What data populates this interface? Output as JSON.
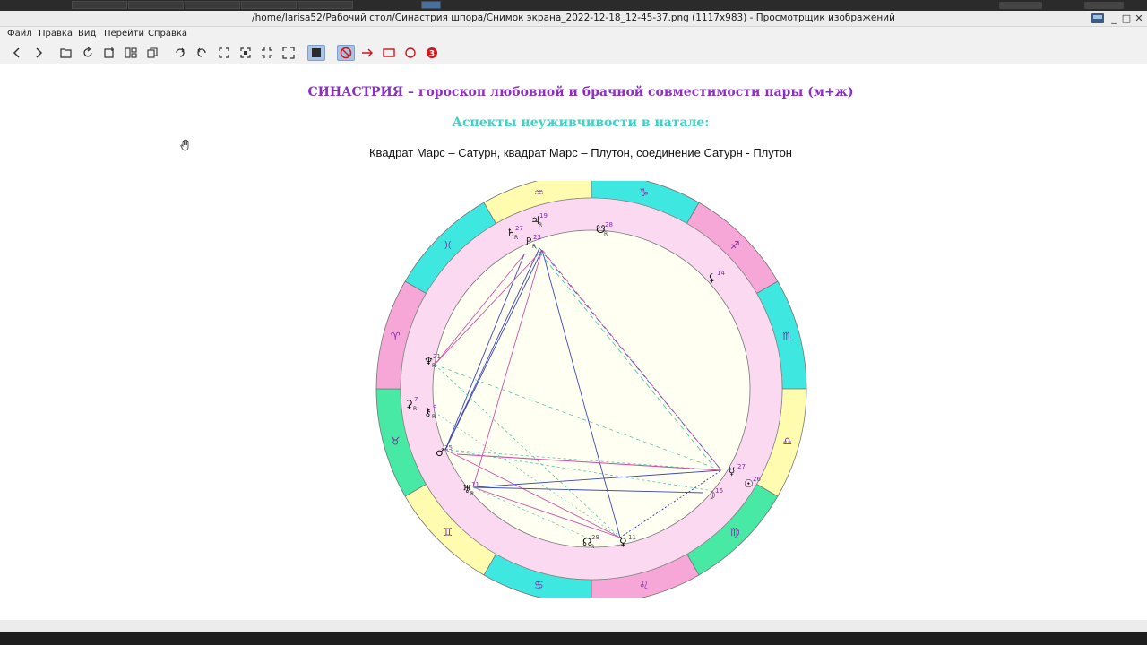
{
  "window": {
    "title": "/home/larisa52/Рабочий стол/Синастрия шпора/Снимок экрана_2022-12-18_12-45-37.png (1117x983) - Просмотрщик изображений"
  },
  "menu": {
    "items": [
      "Файл",
      "Правка",
      "Вид",
      "Перейти",
      "Справка"
    ]
  },
  "toolbar": {
    "buttons": [
      {
        "icon": "back-arrow-icon"
      },
      {
        "icon": "forward-arrow-icon"
      },
      {
        "icon": "open-folder-icon"
      },
      {
        "icon": "reload-icon"
      },
      {
        "icon": "save-as-icon"
      },
      {
        "icon": "thumbnails-icon"
      },
      {
        "icon": "copy-icon"
      },
      {
        "icon": "rotate-right-icon"
      },
      {
        "icon": "rotate-left-icon"
      },
      {
        "icon": "fit-window-icon"
      },
      {
        "icon": "zoom-in-icon"
      },
      {
        "icon": "zoom-out-icon"
      },
      {
        "icon": "fullscreen-icon"
      },
      {
        "icon": "fill-square-icon"
      },
      {
        "icon": "no-annotation-icon"
      },
      {
        "icon": "arrow-tool-icon"
      },
      {
        "icon": "rectangle-tool-icon"
      },
      {
        "icon": "circle-tool-icon"
      },
      {
        "icon": "number-tool-icon",
        "label": "3"
      }
    ],
    "annotation_color": "#d0161e",
    "pressed_color": "#a9c4e4"
  },
  "content": {
    "heading_main": "СИНАСТРИЯ – гороскоп любовной и брачной совместимости пары (м+ж)",
    "heading_sub": "Аспекты неуживчивости в натале:",
    "aspects_text": "Квадрат Марс – Сатурн, квадрат Марс – Плутон, соединение Сатурн - Плутон",
    "colors": {
      "heading_main": "#8a2fc3",
      "heading_sub": "#3fd0c6",
      "aspects_text": "#111111"
    }
  },
  "natal_chart": {
    "zodiac_signs": [
      {
        "name": "capricorn",
        "glyph": "♑"
      },
      {
        "name": "sagittarius",
        "glyph": "♐"
      },
      {
        "name": "scorpio",
        "glyph": "♏"
      },
      {
        "name": "libra",
        "glyph": "♎"
      },
      {
        "name": "virgo",
        "glyph": "♍"
      },
      {
        "name": "leo",
        "glyph": "♌"
      },
      {
        "name": "cancer",
        "glyph": "♋"
      },
      {
        "name": "gemini",
        "glyph": "♊"
      },
      {
        "name": "taurus",
        "glyph": "♉"
      },
      {
        "name": "aries",
        "glyph": "♈"
      },
      {
        "name": "pisces",
        "glyph": "♓"
      },
      {
        "name": "aquarius",
        "glyph": "♒"
      }
    ],
    "sign_colors": [
      "#3ee8e0",
      "#f7a6d8",
      "#3ee8e0",
      "#fffcb0",
      "#48e8a5",
      "#f7a6d8",
      "#3ee8e0",
      "#fffcb0",
      "#48e8a5",
      "#f7a6d8",
      "#3ee8e0",
      "#fffcb0"
    ],
    "planets": [
      {
        "name": "saturn",
        "glyph": "♄",
        "degree": "27",
        "retro": "R"
      },
      {
        "name": "jupiter",
        "glyph": "♃",
        "degree": "19",
        "retro": "R"
      },
      {
        "name": "pluto",
        "glyph": "♇",
        "degree": "23",
        "retro": "R"
      },
      {
        "name": "south-node",
        "glyph": "☋",
        "degree": "28",
        "retro": "R"
      },
      {
        "name": "lilith",
        "glyph": "⚸",
        "degree": "14",
        "retro": ""
      },
      {
        "name": "neptune",
        "glyph": "♆",
        "degree": "21",
        "retro": "R"
      },
      {
        "name": "ceres",
        "glyph": "⚳",
        "degree": "7",
        "retro": "R"
      },
      {
        "name": "chiron",
        "glyph": "⚷",
        "degree": "9",
        "retro": "R"
      },
      {
        "name": "mars",
        "glyph": "♂",
        "degree": "25",
        "retro": ""
      },
      {
        "name": "uranus",
        "glyph": "♅",
        "degree": "11",
        "retro": "R"
      },
      {
        "name": "north-node",
        "glyph": "☊",
        "degree": "28",
        "retro": "R"
      },
      {
        "name": "venus",
        "glyph": "♀",
        "degree": "11",
        "retro": ""
      },
      {
        "name": "moon",
        "glyph": "☽",
        "degree": "16",
        "retro": ""
      },
      {
        "name": "sun",
        "glyph": "☉",
        "degree": "26",
        "retro": ""
      },
      {
        "name": "mercury",
        "glyph": "☿",
        "degree": "27",
        "retro": ""
      }
    ],
    "planet_glyph_color": "#111111",
    "degree_color": "#7b2fa8"
  }
}
